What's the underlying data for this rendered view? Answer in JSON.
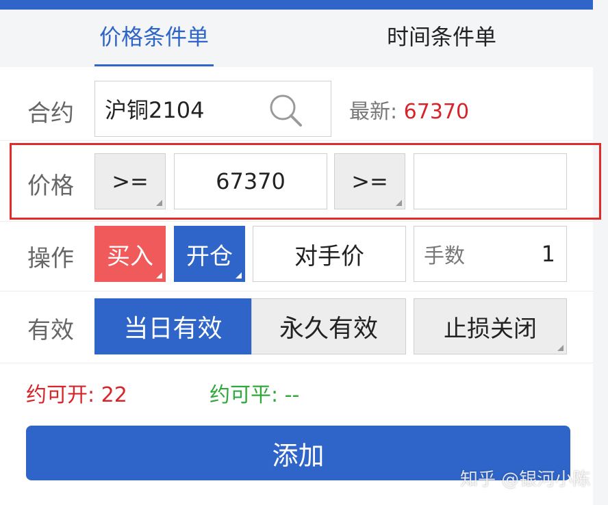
{
  "tabs": [
    {
      "label": "价格条件单",
      "active": true
    },
    {
      "label": "时间条件单",
      "active": false
    }
  ],
  "contract": {
    "label": "合约",
    "value": "沪铜2104",
    "search_icon": "search-icon",
    "latest_label": "最新:",
    "latest_value": "67370"
  },
  "price": {
    "label": "价格",
    "op1": ">=",
    "value1": "67370",
    "op2": ">=",
    "value2": ""
  },
  "operation": {
    "label": "操作",
    "direction": "买入",
    "offset": "开仓",
    "price_type": "对手价",
    "qty_label": "手数",
    "qty_value": "1"
  },
  "validity": {
    "label": "有效",
    "today": "当日有效",
    "permanent": "永久有效",
    "stop": "止损关闭"
  },
  "stats": {
    "open_label": "约可开:",
    "open_value": "22",
    "close_label": "约可平:",
    "close_value": "--"
  },
  "add_button": "添加",
  "watermark": "知乎 @银河小陈",
  "colors": {
    "accent": "#2f64c8",
    "buy": "#f05a5a",
    "price_red": "#d8232a",
    "green": "#2ea83a",
    "frame": "#e02b2b"
  }
}
